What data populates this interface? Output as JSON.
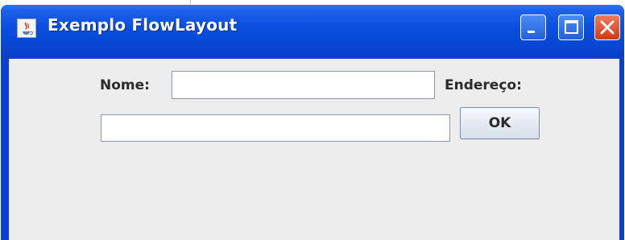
{
  "window": {
    "title": "Exemplo FlowLayout",
    "controls": {
      "minimize": "minimize-icon",
      "maximize": "maximize-icon",
      "close": "close-icon"
    }
  },
  "form": {
    "nome_label": "Nome:",
    "nome_value": "",
    "endereco_label": "Endereço:",
    "endereco_value": "",
    "ok_label": "OK"
  },
  "colors": {
    "titlebar": "#0a4fe0",
    "content": "#ededed",
    "close": "#d23a12"
  }
}
